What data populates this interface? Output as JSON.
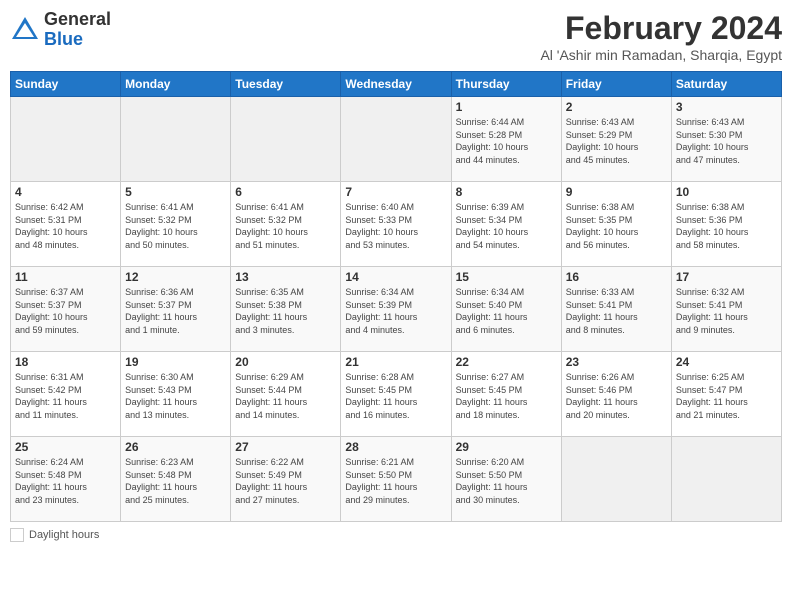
{
  "logo": {
    "general": "General",
    "blue": "Blue"
  },
  "title": "February 2024",
  "location": "Al 'Ashir min Ramadan, Sharqia, Egypt",
  "days_of_week": [
    "Sunday",
    "Monday",
    "Tuesday",
    "Wednesday",
    "Thursday",
    "Friday",
    "Saturday"
  ],
  "legend": {
    "label": "Daylight hours"
  },
  "weeks": [
    [
      {
        "day": "",
        "info": ""
      },
      {
        "day": "",
        "info": ""
      },
      {
        "day": "",
        "info": ""
      },
      {
        "day": "",
        "info": ""
      },
      {
        "day": "1",
        "info": "Sunrise: 6:44 AM\nSunset: 5:28 PM\nDaylight: 10 hours\nand 44 minutes."
      },
      {
        "day": "2",
        "info": "Sunrise: 6:43 AM\nSunset: 5:29 PM\nDaylight: 10 hours\nand 45 minutes."
      },
      {
        "day": "3",
        "info": "Sunrise: 6:43 AM\nSunset: 5:30 PM\nDaylight: 10 hours\nand 47 minutes."
      }
    ],
    [
      {
        "day": "4",
        "info": "Sunrise: 6:42 AM\nSunset: 5:31 PM\nDaylight: 10 hours\nand 48 minutes."
      },
      {
        "day": "5",
        "info": "Sunrise: 6:41 AM\nSunset: 5:32 PM\nDaylight: 10 hours\nand 50 minutes."
      },
      {
        "day": "6",
        "info": "Sunrise: 6:41 AM\nSunset: 5:32 PM\nDaylight: 10 hours\nand 51 minutes."
      },
      {
        "day": "7",
        "info": "Sunrise: 6:40 AM\nSunset: 5:33 PM\nDaylight: 10 hours\nand 53 minutes."
      },
      {
        "day": "8",
        "info": "Sunrise: 6:39 AM\nSunset: 5:34 PM\nDaylight: 10 hours\nand 54 minutes."
      },
      {
        "day": "9",
        "info": "Sunrise: 6:38 AM\nSunset: 5:35 PM\nDaylight: 10 hours\nand 56 minutes."
      },
      {
        "day": "10",
        "info": "Sunrise: 6:38 AM\nSunset: 5:36 PM\nDaylight: 10 hours\nand 58 minutes."
      }
    ],
    [
      {
        "day": "11",
        "info": "Sunrise: 6:37 AM\nSunset: 5:37 PM\nDaylight: 10 hours\nand 59 minutes."
      },
      {
        "day": "12",
        "info": "Sunrise: 6:36 AM\nSunset: 5:37 PM\nDaylight: 11 hours\nand 1 minute."
      },
      {
        "day": "13",
        "info": "Sunrise: 6:35 AM\nSunset: 5:38 PM\nDaylight: 11 hours\nand 3 minutes."
      },
      {
        "day": "14",
        "info": "Sunrise: 6:34 AM\nSunset: 5:39 PM\nDaylight: 11 hours\nand 4 minutes."
      },
      {
        "day": "15",
        "info": "Sunrise: 6:34 AM\nSunset: 5:40 PM\nDaylight: 11 hours\nand 6 minutes."
      },
      {
        "day": "16",
        "info": "Sunrise: 6:33 AM\nSunset: 5:41 PM\nDaylight: 11 hours\nand 8 minutes."
      },
      {
        "day": "17",
        "info": "Sunrise: 6:32 AM\nSunset: 5:41 PM\nDaylight: 11 hours\nand 9 minutes."
      }
    ],
    [
      {
        "day": "18",
        "info": "Sunrise: 6:31 AM\nSunset: 5:42 PM\nDaylight: 11 hours\nand 11 minutes."
      },
      {
        "day": "19",
        "info": "Sunrise: 6:30 AM\nSunset: 5:43 PM\nDaylight: 11 hours\nand 13 minutes."
      },
      {
        "day": "20",
        "info": "Sunrise: 6:29 AM\nSunset: 5:44 PM\nDaylight: 11 hours\nand 14 minutes."
      },
      {
        "day": "21",
        "info": "Sunrise: 6:28 AM\nSunset: 5:45 PM\nDaylight: 11 hours\nand 16 minutes."
      },
      {
        "day": "22",
        "info": "Sunrise: 6:27 AM\nSunset: 5:45 PM\nDaylight: 11 hours\nand 18 minutes."
      },
      {
        "day": "23",
        "info": "Sunrise: 6:26 AM\nSunset: 5:46 PM\nDaylight: 11 hours\nand 20 minutes."
      },
      {
        "day": "24",
        "info": "Sunrise: 6:25 AM\nSunset: 5:47 PM\nDaylight: 11 hours\nand 21 minutes."
      }
    ],
    [
      {
        "day": "25",
        "info": "Sunrise: 6:24 AM\nSunset: 5:48 PM\nDaylight: 11 hours\nand 23 minutes."
      },
      {
        "day": "26",
        "info": "Sunrise: 6:23 AM\nSunset: 5:48 PM\nDaylight: 11 hours\nand 25 minutes."
      },
      {
        "day": "27",
        "info": "Sunrise: 6:22 AM\nSunset: 5:49 PM\nDaylight: 11 hours\nand 27 minutes."
      },
      {
        "day": "28",
        "info": "Sunrise: 6:21 AM\nSunset: 5:50 PM\nDaylight: 11 hours\nand 29 minutes."
      },
      {
        "day": "29",
        "info": "Sunrise: 6:20 AM\nSunset: 5:50 PM\nDaylight: 11 hours\nand 30 minutes."
      },
      {
        "day": "",
        "info": ""
      },
      {
        "day": "",
        "info": ""
      }
    ]
  ]
}
